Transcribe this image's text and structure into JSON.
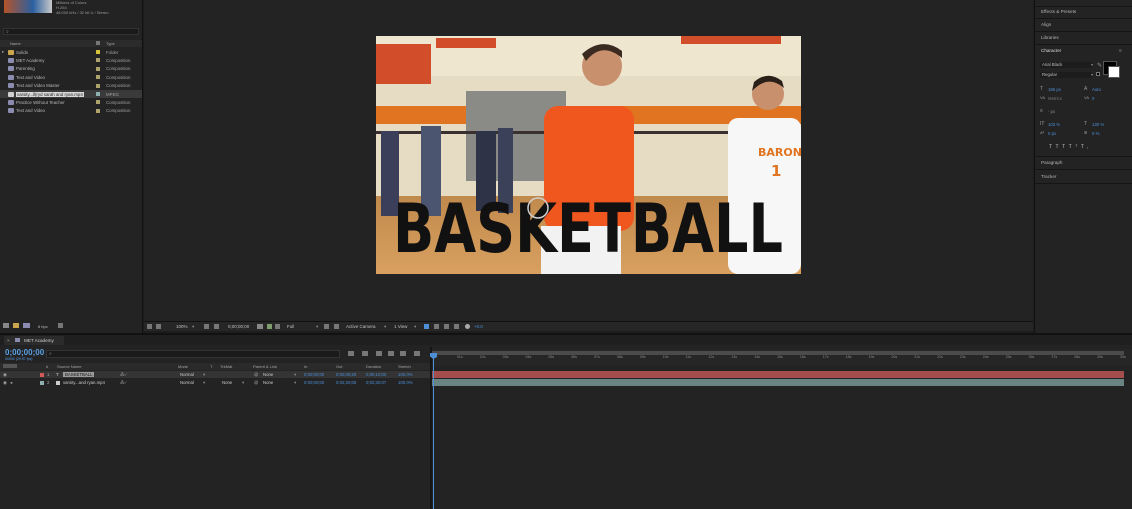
{
  "project": {
    "meta": [
      "Millions of Colors",
      "H.264",
      "48.000 kHz / 32 bit U / Stereo"
    ],
    "columns": {
      "name": "Name",
      "type": "Type"
    },
    "items": [
      {
        "name": "Solids",
        "type": "Folder",
        "kind": "folder"
      },
      {
        "name": "MET Academy",
        "type": "Composition",
        "kind": "comp"
      },
      {
        "name": "Parenting",
        "type": "Composition",
        "kind": "comp"
      },
      {
        "name": "Text and Video",
        "type": "Composition",
        "kind": "comp"
      },
      {
        "name": "Text and Video Master",
        "type": "Composition",
        "kind": "comp"
      },
      {
        "name": "varsity...ll(ryd sarah and ryan.mp4",
        "type": "MPEG",
        "kind": "mpeg",
        "selected": true
      },
      {
        "name": "Practice Without Teacher",
        "type": "Composition",
        "kind": "comp"
      },
      {
        "name": "Text and Video",
        "type": "Composition",
        "kind": "comp"
      }
    ],
    "footer_bpc": "8 bpc"
  },
  "viewer": {
    "overlay_text": "BASKETBALL",
    "jersey_text": "BARONS",
    "jersey_number": "1",
    "zoom": "100%",
    "timecode": "0;00;00;00",
    "resolution": "Full",
    "camera": "Active Camera",
    "views": "1 View",
    "exposure": "+0.0"
  },
  "right_panels": {
    "effects": "Effects & Presets",
    "align": "Align",
    "libraries": "Libraries",
    "character": "Character",
    "font_family": "Arial Black",
    "font_style": "Regular",
    "font_size": "186 px",
    "leading": "Auto",
    "kerning": "Metrics",
    "tracking": "0",
    "stroke_unit": "- px",
    "vert_scale": "103 %",
    "horiz_scale": "130 %",
    "baseline": "0 px",
    "tsume": "0 %",
    "paragraph": "Paragraph",
    "tracker": "Tracker",
    "fill_color": "#000000",
    "stroke_color": "#ffffff"
  },
  "timeline": {
    "tab": "MET Academy",
    "current_time": "0;00;00;00",
    "fps": "00000 (29.97 fps)",
    "columns": {
      "source": "Source Name",
      "mode": "Mode",
      "t": "T",
      "trkmat": "TrkMat",
      "parent": "Parent & Link",
      "in": "In",
      "out": "Out",
      "duration": "Duration",
      "stretch": "Stretch"
    },
    "layers": [
      {
        "num": "1",
        "name": "BASKETBALL",
        "mode": "Normal",
        "trkmat": "",
        "parent": "None",
        "in": "0;00;00;00",
        "out": "0;00;09;29",
        "duration": "0;00;10;00",
        "stretch": "100.0%"
      },
      {
        "num": "2",
        "name": "varsity...and ryan.mp4",
        "mode": "Normal",
        "trkmat": "None",
        "parent": "None",
        "in": "0;00;00;00",
        "out": "0;02;30;06",
        "duration": "0;02;30;07",
        "stretch": "100.0%"
      }
    ],
    "ruler": [
      "0f",
      "01s",
      "02s",
      "03s",
      "04s",
      "05s",
      "06s",
      "07s",
      "08s",
      "09s",
      "10s",
      "11s",
      "12s",
      "13s",
      "14s",
      "15s",
      "16s",
      "17s",
      "18s",
      "19s",
      "20s",
      "21s",
      "22s",
      "23s",
      "24s",
      "25s",
      "26s",
      "27s",
      "28s",
      "29s",
      "30s"
    ]
  }
}
